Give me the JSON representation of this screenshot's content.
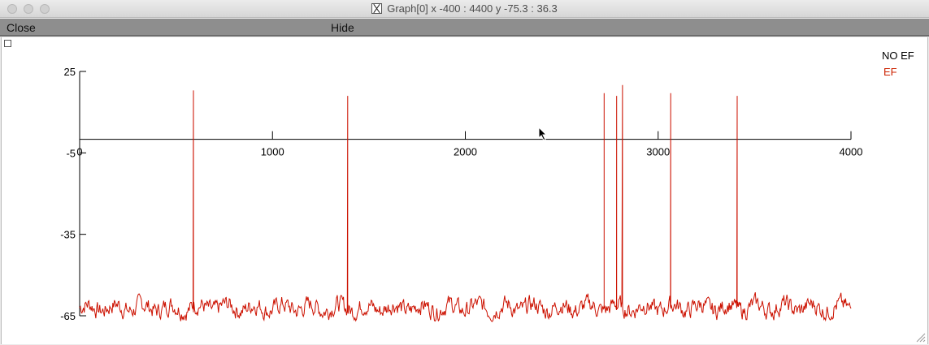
{
  "window": {
    "title": "Graph[0]  x -400 : 4400  y -75.3 : 36.3",
    "app_icon": "x11-icon"
  },
  "menu": {
    "close_label": "Close",
    "hide_label": "Hide"
  },
  "legend": {
    "no_ef": "NO EF",
    "ef": "EF"
  },
  "colors": {
    "trace": "#cc1100",
    "axis": "#000000",
    "menubar": "#8e8e8e"
  },
  "chart_data": {
    "type": "line",
    "xlim": [
      -400,
      4400
    ],
    "ylim": [
      -75.3,
      36.3
    ],
    "x_ticks": [
      0,
      1000,
      2000,
      3000,
      4000
    ],
    "x_tick_labels": [
      "0",
      "1000",
      "2000",
      "3000",
      "4000"
    ],
    "y_ticks": [
      25,
      -5,
      -35,
      -65
    ],
    "y_tick_labels": [
      "25",
      "-5",
      "-35",
      "-65"
    ],
    "x_axis_at_y": 0,
    "series": [
      {
        "name": "NO EF",
        "color": "#000000",
        "values": []
      },
      {
        "name": "EF",
        "color": "#cc1100",
        "baseline": -62,
        "noise_amplitude": 3,
        "x_range": [
          0,
          4000
        ],
        "spikes": [
          {
            "x": 590,
            "peak": 18
          },
          {
            "x": 1390,
            "peak": 16
          },
          {
            "x": 2720,
            "peak": 17
          },
          {
            "x": 2785,
            "peak": 16
          },
          {
            "x": 2815,
            "peak": 20
          },
          {
            "x": 3065,
            "peak": 17
          },
          {
            "x": 3410,
            "peak": 16
          }
        ]
      }
    ]
  }
}
